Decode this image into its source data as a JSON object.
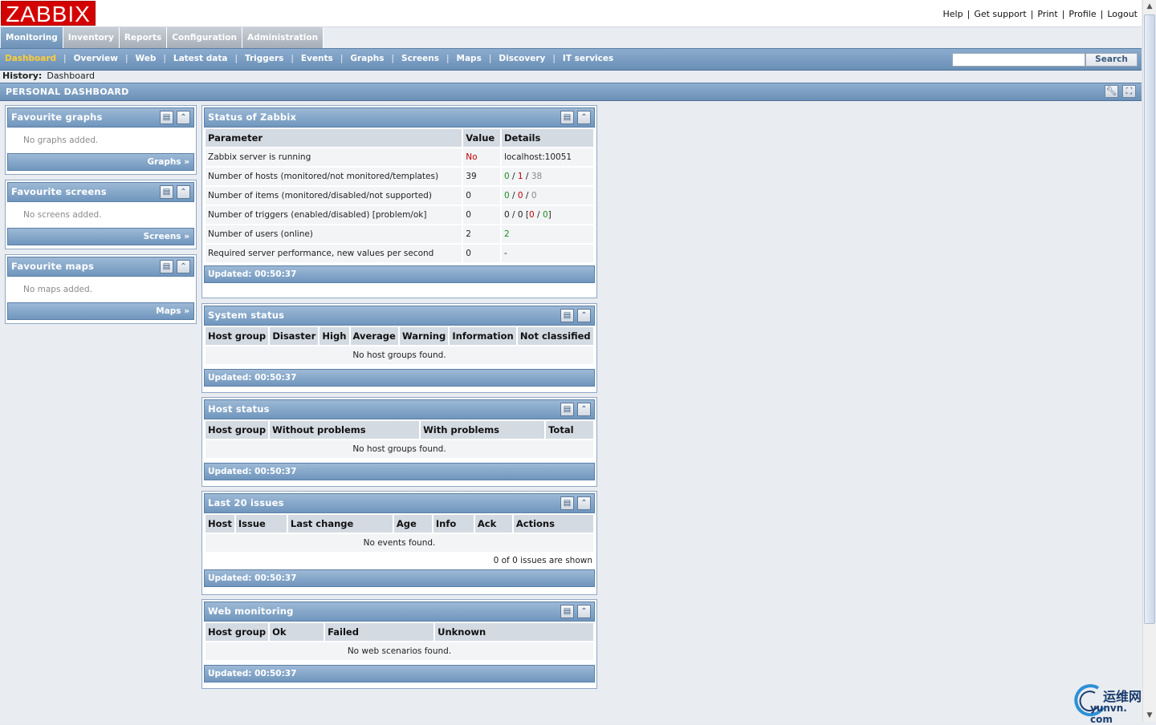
{
  "logo": "ZABBIX",
  "top_links": [
    "Help",
    "Get support",
    "Print",
    "Profile",
    "Logout"
  ],
  "main_menu": [
    "Monitoring",
    "Inventory",
    "Reports",
    "Configuration",
    "Administration"
  ],
  "sub_menu": [
    "Dashboard",
    "Overview",
    "Web",
    "Latest data",
    "Triggers",
    "Events",
    "Graphs",
    "Screens",
    "Maps",
    "Discovery",
    "IT services"
  ],
  "search": {
    "button": "Search",
    "value": ""
  },
  "history": {
    "label": "History:",
    "value": "Dashboard"
  },
  "page_title": "PERSONAL DASHBOARD",
  "favourites": [
    {
      "title": "Favourite graphs",
      "empty": "No graphs added.",
      "link": "Graphs »"
    },
    {
      "title": "Favourite screens",
      "empty": "No screens added.",
      "link": "Screens »"
    },
    {
      "title": "Favourite maps",
      "empty": "No maps added.",
      "link": "Maps »"
    }
  ],
  "status": {
    "title": "Status of Zabbix",
    "headers": [
      "Parameter",
      "Value",
      "Details"
    ],
    "rows": [
      {
        "param": "Zabbix server is running",
        "value": "No",
        "details": "localhost:10051"
      },
      {
        "param": "Number of hosts (monitored/not monitored/templates)",
        "value": "39",
        "d1": "0",
        "d2": "1",
        "d3": "38"
      },
      {
        "param": "Number of items (monitored/disabled/not supported)",
        "value": "0",
        "d1": "0",
        "d2": "0",
        "d3": "0"
      },
      {
        "param": "Number of triggers (enabled/disabled) [problem/ok]",
        "value": "0",
        "d1": "0",
        "d2": "0",
        "d3": "0",
        "d4": "0"
      },
      {
        "param": "Number of users (online)",
        "value": "2",
        "details": "2"
      },
      {
        "param": "Required server performance, new values per second",
        "value": "0",
        "details": "-"
      }
    ],
    "updated": "Updated: 00:50:37"
  },
  "system_status": {
    "title": "System status",
    "headers": [
      "Host group",
      "Disaster",
      "High",
      "Average",
      "Warning",
      "Information",
      "Not classified"
    ],
    "empty": "No host groups found.",
    "updated": "Updated: 00:50:37"
  },
  "host_status": {
    "title": "Host status",
    "headers": [
      "Host group",
      "Without problems",
      "With problems",
      "Total"
    ],
    "empty": "No host groups found.",
    "updated": "Updated: 00:50:37"
  },
  "last_issues": {
    "title": "Last 20 issues",
    "headers": [
      "Host",
      "Issue",
      "Last change",
      "Age",
      "Info",
      "Ack",
      "Actions"
    ],
    "empty": "No events found.",
    "shown": "0 of 0 issues are shown",
    "updated": "Updated: 00:50:37"
  },
  "web_monitoring": {
    "title": "Web monitoring",
    "headers": [
      "Host group",
      "Ok",
      "Failed",
      "Unknown"
    ],
    "empty": "No web scenarios found.",
    "updated": "Updated: 00:50:37"
  },
  "watermark": {
    "cn": "运维网",
    "en": "yunvn. com"
  },
  "colors": {
    "accent": "#7096bd",
    "problem": "#c00000",
    "ok": "#1e8f1e",
    "active_submenu": "#ffcc33",
    "logo": "#d40000"
  }
}
